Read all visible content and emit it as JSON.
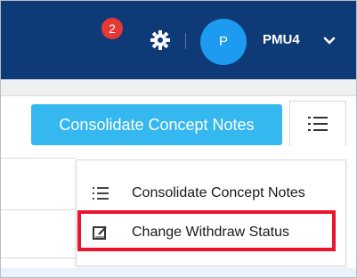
{
  "header": {
    "notification_count": "2",
    "avatar_initial": "P",
    "username": "PMU4"
  },
  "toolbar": {
    "consolidate_button_label": "Consolidate Concept Notes"
  },
  "dropdown": {
    "items": [
      {
        "label": "Consolidate Concept Notes",
        "icon": "list-icon"
      },
      {
        "label": "Change Withdraw Status",
        "icon": "edit-icon"
      }
    ]
  },
  "colors": {
    "header_bg": "#0f3a78",
    "button_bg": "#35b7f0",
    "avatar_bg": "#1c9bf0",
    "badge_bg": "#e53935",
    "highlight_border": "#e8152d"
  }
}
